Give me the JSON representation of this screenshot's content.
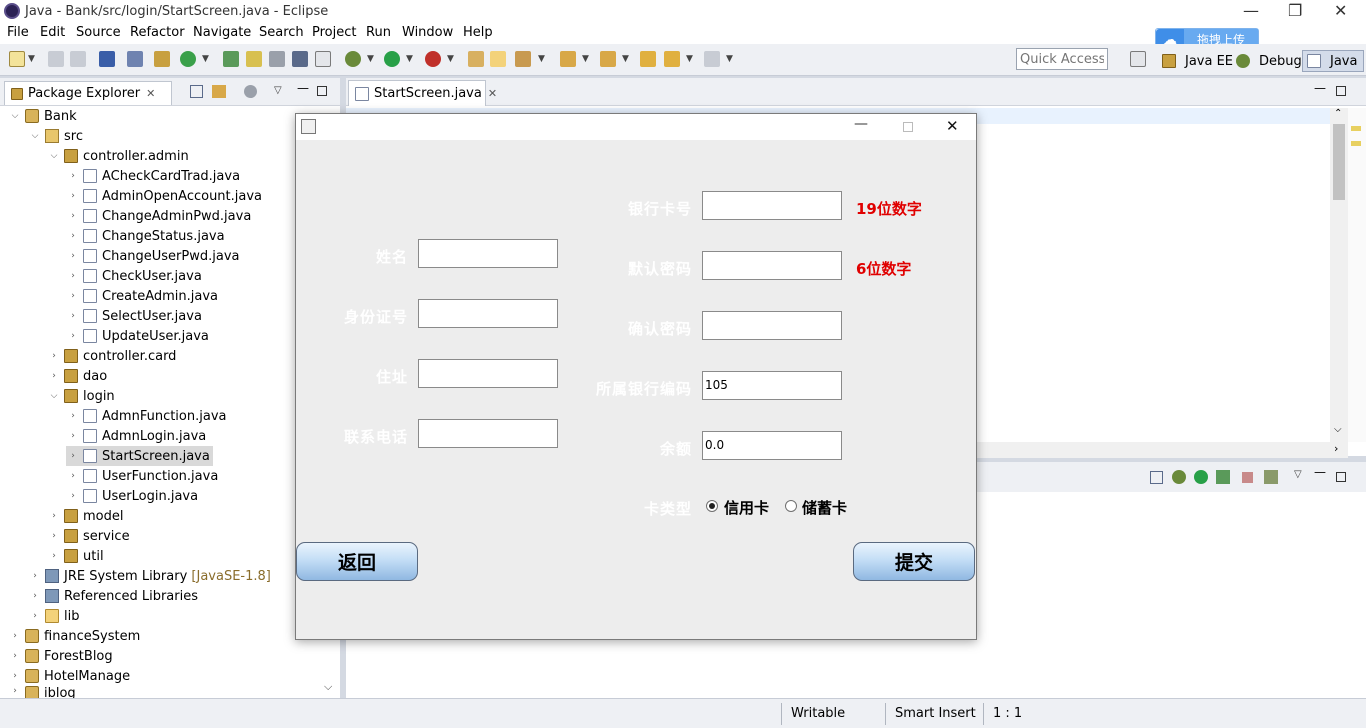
{
  "window": {
    "title": "Java - Bank/src/login/StartScreen.java - Eclipse",
    "minimize": "—",
    "restore": "❐",
    "close": "✕"
  },
  "menu": [
    "File",
    "Edit",
    "Source",
    "Refactor",
    "Navigate",
    "Search",
    "Project",
    "Run",
    "Window",
    "Help"
  ],
  "toolbar": {
    "quick_access": "Quick Access",
    "perspectives": [
      "Java EE",
      "Debug",
      "Java"
    ],
    "upload_label": "拖拽上传"
  },
  "package_explorer": {
    "title": "Package Explorer",
    "items": [
      "Bank",
      "src",
      "controller.admin",
      "ACheckCardTrad.java",
      "AdminOpenAccount.java",
      "ChangeAdminPwd.java",
      "ChangeStatus.java",
      "ChangeUserPwd.java",
      "CheckUser.java",
      "CreateAdmin.java",
      "SelectUser.java",
      "UpdateUser.java",
      "controller.card",
      "dao",
      "login",
      "AdmnFunction.java",
      "AdmnLogin.java",
      "StartScreen.java",
      "UserFunction.java",
      "UserLogin.java",
      "model",
      "service",
      "util",
      "JRE System Library",
      "Referenced Libraries",
      "lib",
      "financeSystem",
      "ForestBlog",
      "HotelManage",
      "iblog"
    ],
    "jre_suffix": "[JavaSE-1.8]"
  },
  "editor": {
    "tab": "StartScreen.java"
  },
  "status": {
    "writable": "Writable",
    "insert_mode": "Smart Insert",
    "position": "1 : 1"
  },
  "dialog": {
    "left_fields": [
      {
        "label": "姓名",
        "value": ""
      },
      {
        "label": "身份证号",
        "value": ""
      },
      {
        "label": "住址",
        "value": ""
      },
      {
        "label": "联系电话",
        "value": ""
      }
    ],
    "right_fields": [
      {
        "label": "银行卡号",
        "value": "",
        "hint": "19位数字"
      },
      {
        "label": "默认密码",
        "value": "",
        "hint": "6位数字"
      },
      {
        "label": "确认密码",
        "value": "",
        "hint": ""
      },
      {
        "label": "所属银行编码",
        "value": "105",
        "hint": ""
      },
      {
        "label": "余额",
        "value": "0.0",
        "hint": ""
      }
    ],
    "card_type": {
      "label": "卡类型",
      "options": [
        "信用卡",
        "储蓄卡"
      ],
      "selected": "信用卡"
    },
    "back_button": "返回",
    "submit_button": "提交"
  }
}
